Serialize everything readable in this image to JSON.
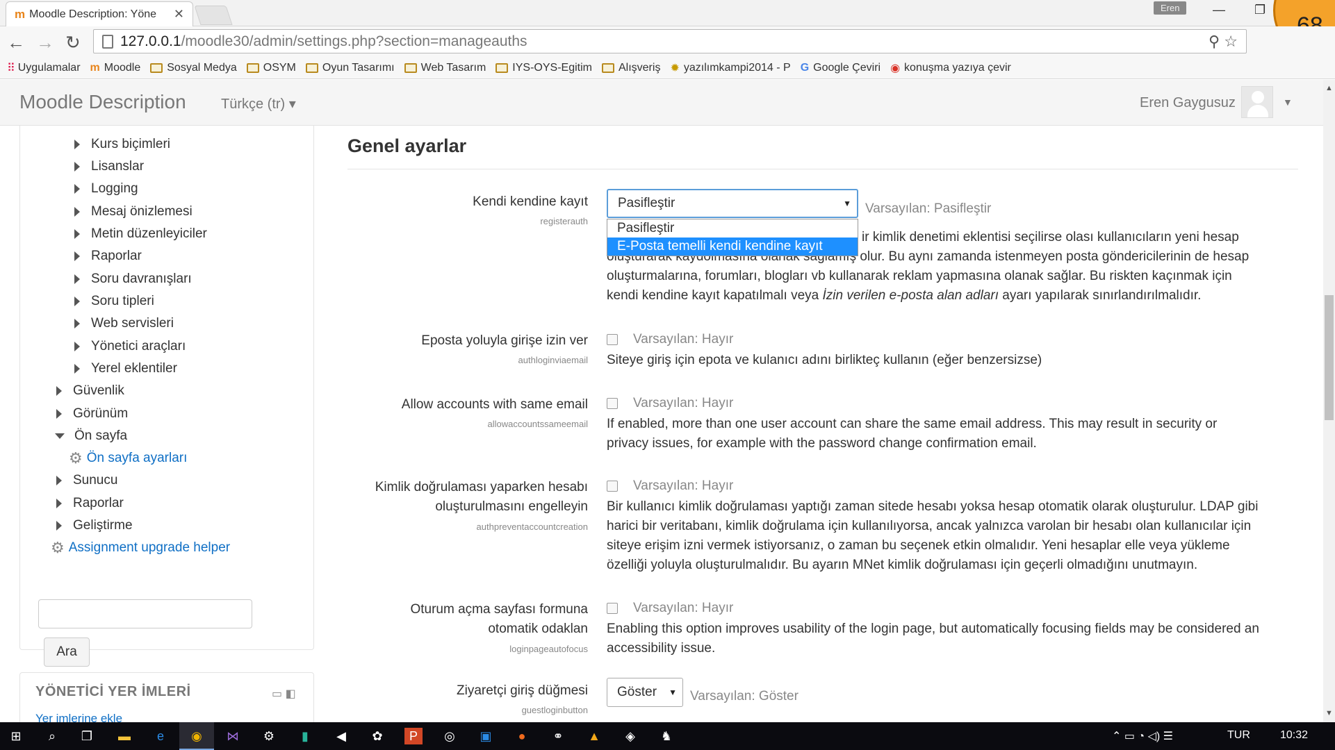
{
  "browser": {
    "tab_title": "Moodle Description: Yöne",
    "profile_name": "Eren",
    "badge_number": "68",
    "url_host": "127.0.0.1",
    "url_path": "/moodle30/admin/settings.php?section=manageauths"
  },
  "bookmarks": [
    {
      "label": "Uygulamalar",
      "icon": "apps-icon"
    },
    {
      "label": "Moodle",
      "icon": "moodle-icon"
    },
    {
      "label": "Sosyal Medya",
      "icon": "folder-icon"
    },
    {
      "label": "OSYM",
      "icon": "folder-icon"
    },
    {
      "label": "Oyun Tasarımı",
      "icon": "folder-icon"
    },
    {
      "label": "Web Tasarım",
      "icon": "folder-icon"
    },
    {
      "label": "IYS-OYS-Egitim",
      "icon": "folder-icon"
    },
    {
      "label": "Alışveriş",
      "icon": "folder-icon"
    },
    {
      "label": "yazılımkampi2014 - P",
      "icon": "site-icon"
    },
    {
      "label": "Google Çeviri",
      "icon": "translate-icon"
    },
    {
      "label": "konuşma yazıya çevir",
      "icon": "chrome-icon"
    }
  ],
  "navbar": {
    "brand": "Moodle Description",
    "language": "Türkçe (tr) ▾",
    "user_name": "Eren Gaygusuz"
  },
  "sidebar": {
    "items": [
      {
        "label": "Kurs biçimleri"
      },
      {
        "label": "Lisanslar"
      },
      {
        "label": "Logging"
      },
      {
        "label": "Mesaj önizlemesi"
      },
      {
        "label": "Metin düzenleyiciler"
      },
      {
        "label": "Raporlar"
      },
      {
        "label": "Soru davranışları"
      },
      {
        "label": "Soru tipleri"
      },
      {
        "label": "Web servisleri"
      },
      {
        "label": "Yönetici araçları"
      },
      {
        "label": "Yerel eklentiler"
      },
      {
        "label": "Güvenlik"
      },
      {
        "label": "Görünüm"
      },
      {
        "label": "Ön sayfa"
      },
      {
        "label": "Ön sayfa ayarları"
      },
      {
        "label": "Sunucu"
      },
      {
        "label": "Raporlar"
      },
      {
        "label": "Geliştirme"
      },
      {
        "label": "Assignment upgrade helper"
      }
    ],
    "search_button": "Ara",
    "bookmarks_block_title": "YÖNETİCİ YER İMLERİ",
    "bookmarks_block_link": "Yer imlerine ekle"
  },
  "main": {
    "heading": "Genel ayarlar",
    "settings": [
      {
        "label": "Kendi kendine kayıt",
        "key": "registerauth",
        "value": "Pasifleştir",
        "default": "Varsayılan: Pasifleştir",
        "options": [
          "Pasifleştir",
          "E-Posta temelli kendi kendine kayıt"
        ],
        "desc_tail": "ir kimlik denetimi eklentisi seçilirse olası kullanıcıların yeni hesap",
        "desc_2": "oluşturarak kaydolmasına olanak sağlamış olur. Bu aynı zamanda istenmeyen posta göndericilerinin de hesap",
        "desc_3": "oluşturmalarına, forumları, blogları vb kullanarak reklam yapmasına olanak sağlar. Bu riskten kaçınmak için",
        "desc_4a": "kendi kendine kayıt kapatılmalı veya ",
        "desc_4b": "İzin verilen e-posta alan adları",
        "desc_4c": " ayarı yapılarak sınırlandırılmalıdır."
      },
      {
        "label": "Eposta yoluyla girişe izin ver",
        "key": "authloginviaemail",
        "default": "Varsayılan: Hayır",
        "desc": "Siteye giriş için epota ve kulanıcı adını birlikteç kullanın (eğer benzersizse)"
      },
      {
        "label": "Allow accounts with same email",
        "key": "allowaccountssameemail",
        "default": "Varsayılan: Hayır",
        "desc_1": "If enabled, more than one user account can share the same email address. This may result in security or",
        "desc_2": "privacy issues, for example with the password change confirmation email."
      },
      {
        "label_1": "Kimlik doğrulaması yaparken hesabı",
        "label_2": "oluşturulmasını engelleyin",
        "key": "authpreventaccountcreation",
        "default": "Varsayılan: Hayır",
        "desc_1": "Bir kullanıcı kimlik doğrulaması yaptığı zaman sitede hesabı yoksa hesap otomatik olarak oluşturulur. LDAP gibi",
        "desc_2": "harici bir veritabanı, kimlik doğrulama için kullanılıyorsa, ancak yalnızca varolan bir hesabı olan kullanıcılar için",
        "desc_3": "siteye erişim izni vermek istiyorsanız, o zaman bu seçenek etkin olmalıdır. Yeni hesaplar elle veya yükleme",
        "desc_4": "özelliği yoluyla oluşturulmalıdır. Bu ayarın MNet kimlik doğrulaması için geçerli olmadığını unutmayın."
      },
      {
        "label_1": "Oturum açma sayfası formuna",
        "label_2": "otomatik odaklan",
        "key": "loginpageautofocus",
        "default": "Varsayılan: Hayır",
        "desc_1": "Enabling this option improves usability of the login page, but automatically focusing fields may be considered an",
        "desc_2": "accessibility issue."
      },
      {
        "label": "Ziyaretçi giriş düğmesi",
        "key": "guestloginbutton",
        "value": "Göster",
        "default": "Varsayılan: Göster"
      }
    ]
  },
  "taskbar": {
    "language": "TUR",
    "time": "10:32"
  }
}
